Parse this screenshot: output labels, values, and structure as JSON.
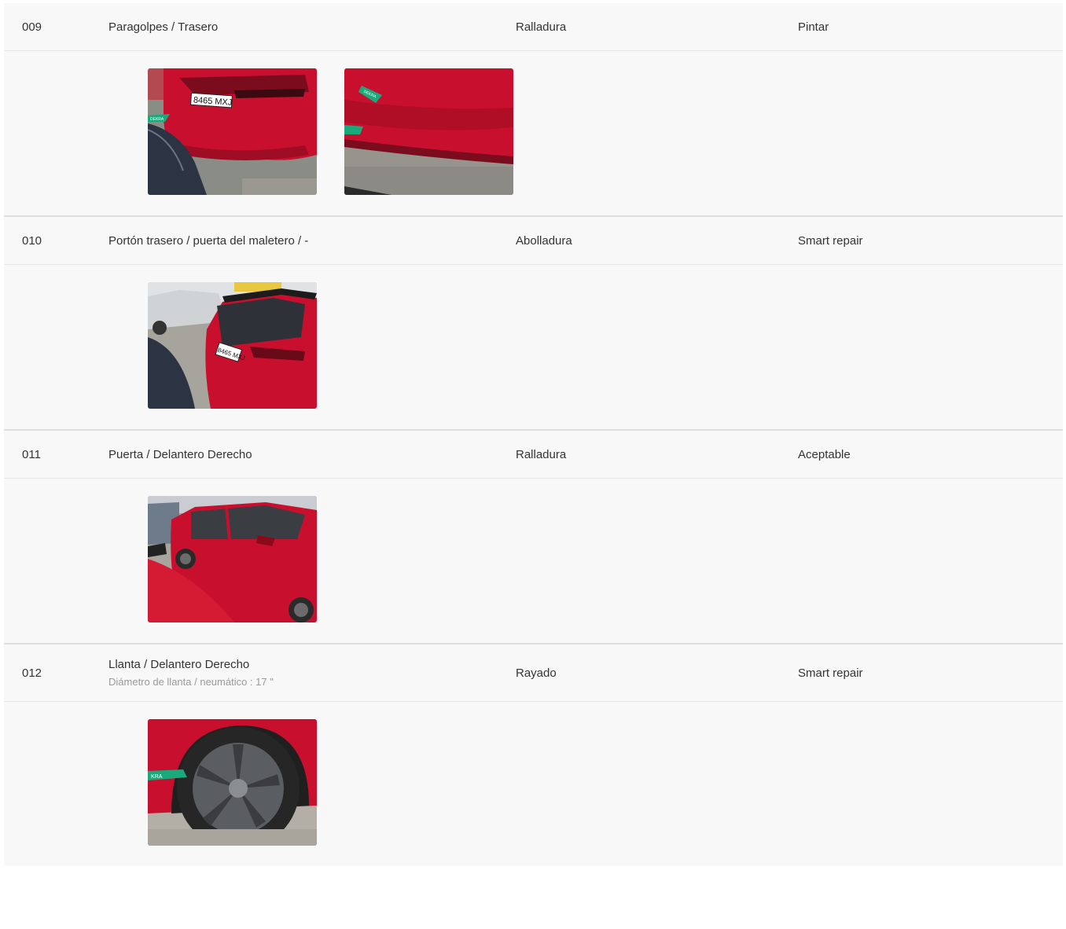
{
  "damages": [
    {
      "code": "009",
      "part": "Paragolpes / Trasero",
      "detail": "",
      "type": "Ralladura",
      "action": "Pintar",
      "photos": [
        {
          "name": "rear-bumper-photo",
          "plate": "8465 MXJ",
          "badge": "DEKRA"
        },
        {
          "name": "rear-bumper-closeup-photo",
          "badge": "DEKRA"
        }
      ]
    },
    {
      "code": "010",
      "part": "Portón trasero / puerta del maletero / -",
      "detail": "",
      "type": "Abolladura",
      "action": "Smart repair",
      "photos": [
        {
          "name": "tailgate-photo",
          "plate": "8465 MXJ"
        }
      ]
    },
    {
      "code": "011",
      "part": "Puerta / Delantero Derecho",
      "detail": "",
      "type": "Ralladura",
      "action": "Aceptable",
      "photos": [
        {
          "name": "front-right-door-photo"
        }
      ]
    },
    {
      "code": "012",
      "part": "Llanta / Delantero Derecho",
      "detail": "Diámetro de llanta / neumático : 17 \"",
      "type": "Rayado",
      "action": "Smart repair",
      "photos": [
        {
          "name": "front-right-wheel-photo",
          "badge": "KRA"
        }
      ]
    }
  ],
  "colors": {
    "car_red": "#c8102e",
    "badge_green": "#1aa97a",
    "row_bg": "#f8f8f8"
  }
}
